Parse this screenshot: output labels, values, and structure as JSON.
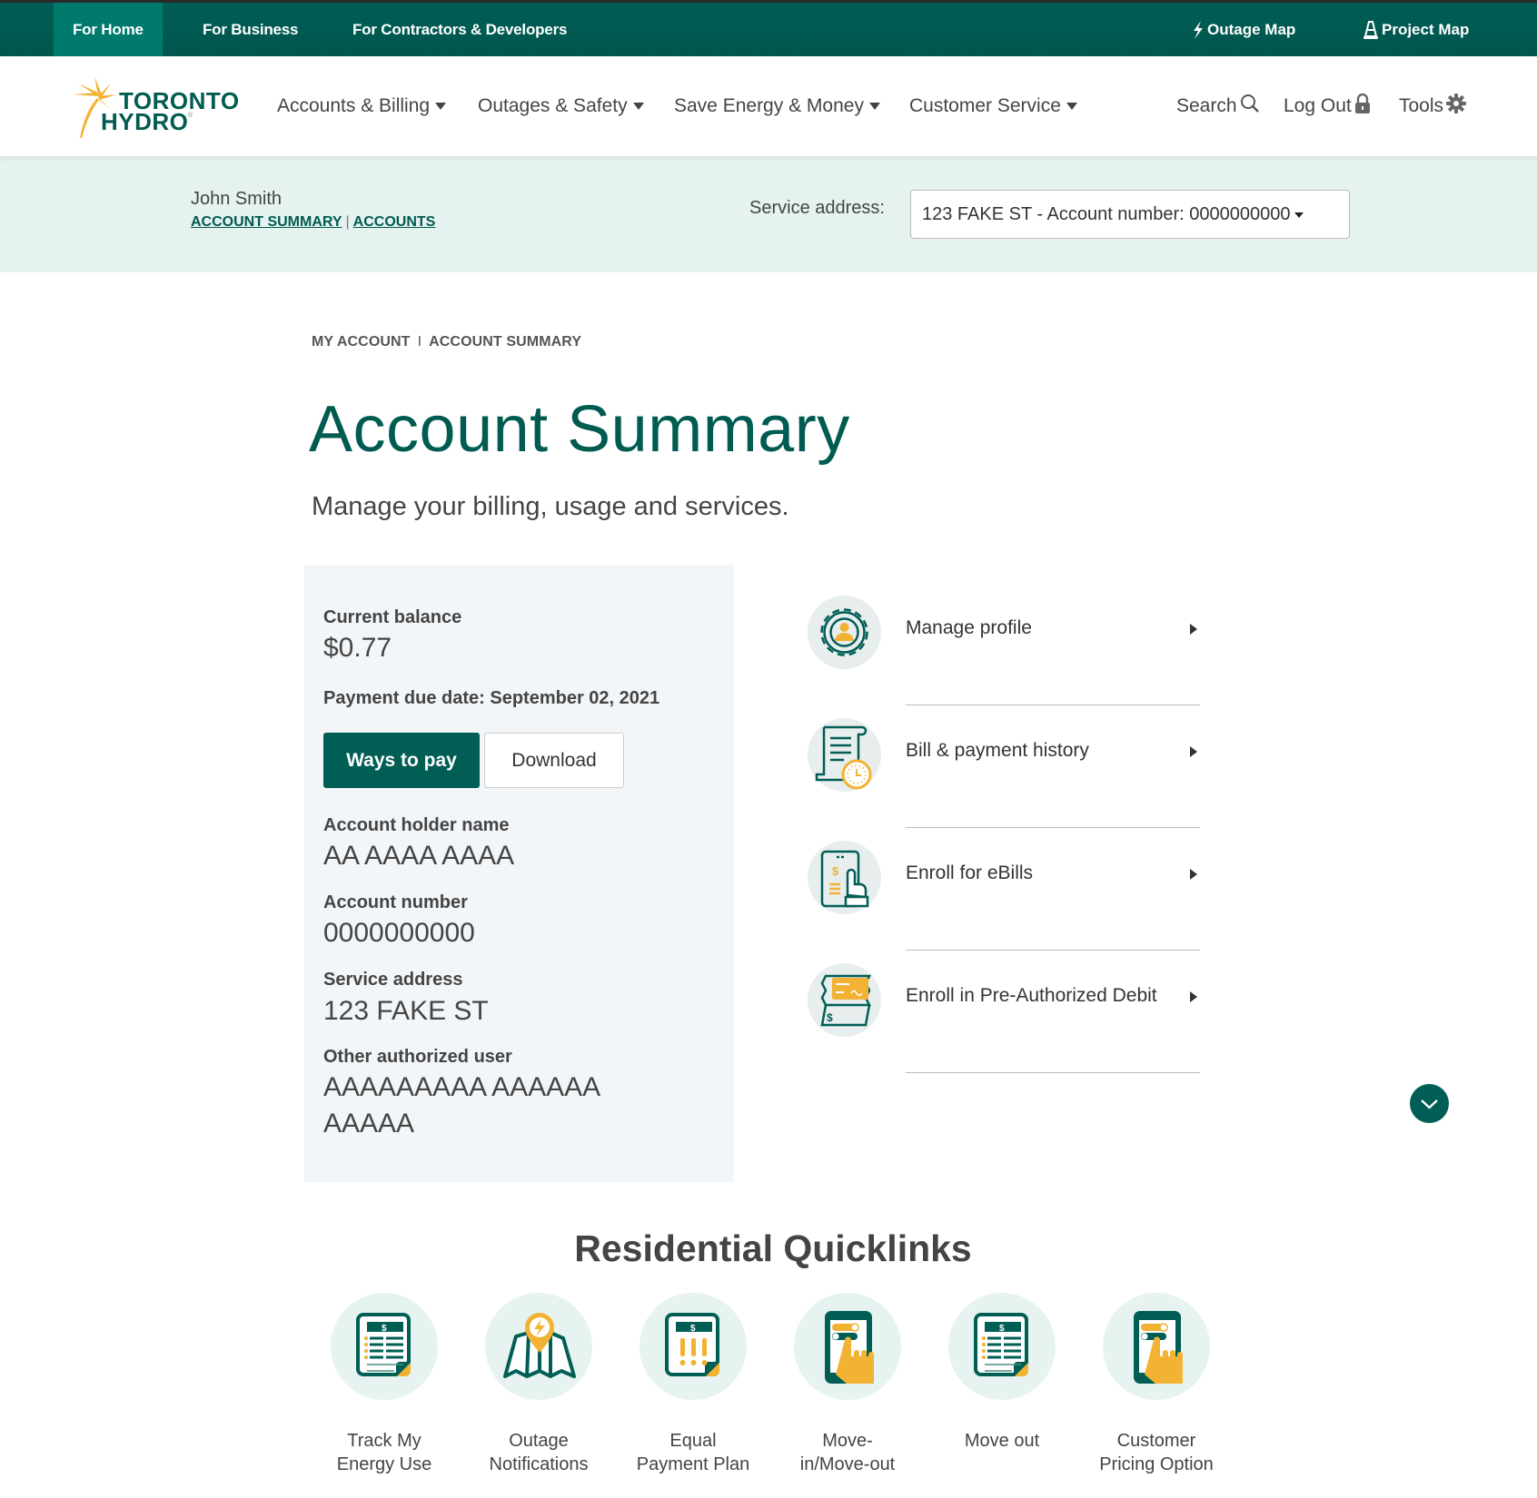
{
  "topbar": {
    "tabs": [
      {
        "label": "For Home",
        "active": true
      },
      {
        "label": "For Business",
        "active": false
      },
      {
        "label": "For Contractors & Developers",
        "active": false
      }
    ],
    "utilities": [
      {
        "label": "Outage Map",
        "icon": "lightning-icon"
      },
      {
        "label": "Project Map",
        "icon": "traffic-cone-icon"
      }
    ]
  },
  "header": {
    "logo": {
      "line1": "TORONTO",
      "line2": "HYDRO",
      "mark": "®"
    },
    "nav": [
      {
        "label": "Accounts & Billing"
      },
      {
        "label": "Outages & Safety"
      },
      {
        "label": "Save Energy & Money"
      },
      {
        "label": "Customer Service"
      }
    ],
    "tools": [
      {
        "label": "Search",
        "icon": "search-icon"
      },
      {
        "label": "Log Out",
        "icon": "lock-icon"
      },
      {
        "label": "Tools",
        "icon": "gear-icon"
      }
    ]
  },
  "account_band": {
    "user_name": "John Smith",
    "links": [
      "ACCOUNT SUMMARY",
      "ACCOUNTS"
    ],
    "separator": "|",
    "service_address_label": "Service address:",
    "service_address_selected": "123 FAKE ST - Account number: 0000000000"
  },
  "breadcrumb": {
    "items": [
      "MY ACCOUNT",
      "ACCOUNT SUMMARY"
    ],
    "separator": "I"
  },
  "page": {
    "title": "Account Summary",
    "subtitle": "Manage your billing, usage and services."
  },
  "summary": {
    "current_balance_label": "Current balance",
    "current_balance": "$0.77",
    "due_date": "Payment due date: September 02, 2021",
    "ways_to_pay": "Ways to pay",
    "download": "Download",
    "holder_label": "Account holder name",
    "holder_value": "AA AAAA AAAA",
    "account_number_label": "Account number",
    "account_number_value": "0000000000",
    "service_address_label": "Service address",
    "service_address_value": "123 FAKE ST",
    "other_user_label": "Other authorized user",
    "other_user_value": "AAAAAAAAA AAAAAA AAAAA"
  },
  "actions": [
    {
      "label": "Manage profile",
      "icon": "profile-gear-icon"
    },
    {
      "label": "Bill & payment history",
      "icon": "bill-clock-icon"
    },
    {
      "label": "Enroll for eBills",
      "icon": "tablet-tap-icon"
    },
    {
      "label": "Enroll in Pre-Authorized Debit",
      "icon": "cheque-icon"
    }
  ],
  "quicklinks": {
    "title": "Residential Quicklinks",
    "items": [
      {
        "label_line1": "Track My",
        "label_line2": "Energy Use",
        "icon": "bill-icon"
      },
      {
        "label_line1": "Outage",
        "label_line2": "Notifications",
        "icon": "map-pin-lightning-icon"
      },
      {
        "label_line1": "Equal",
        "label_line2": "Payment Plan",
        "icon": "bill-alert-icon"
      },
      {
        "label_line1": "Move-",
        "label_line2": "in/Move-out",
        "icon": "phone-tap-icon"
      },
      {
        "label_line1": "Move out",
        "label_line2": "",
        "icon": "bill-icon"
      },
      {
        "label_line1": "Customer",
        "label_line2": "Pricing Option",
        "icon": "phone-tap-icon"
      }
    ]
  },
  "colors": {
    "brand_teal": "#005e55",
    "active_tab": "#007a6d",
    "accent_yellow": "#f2b233",
    "band_bg": "#e6f2f0",
    "card_bg": "#f3f6f9"
  }
}
